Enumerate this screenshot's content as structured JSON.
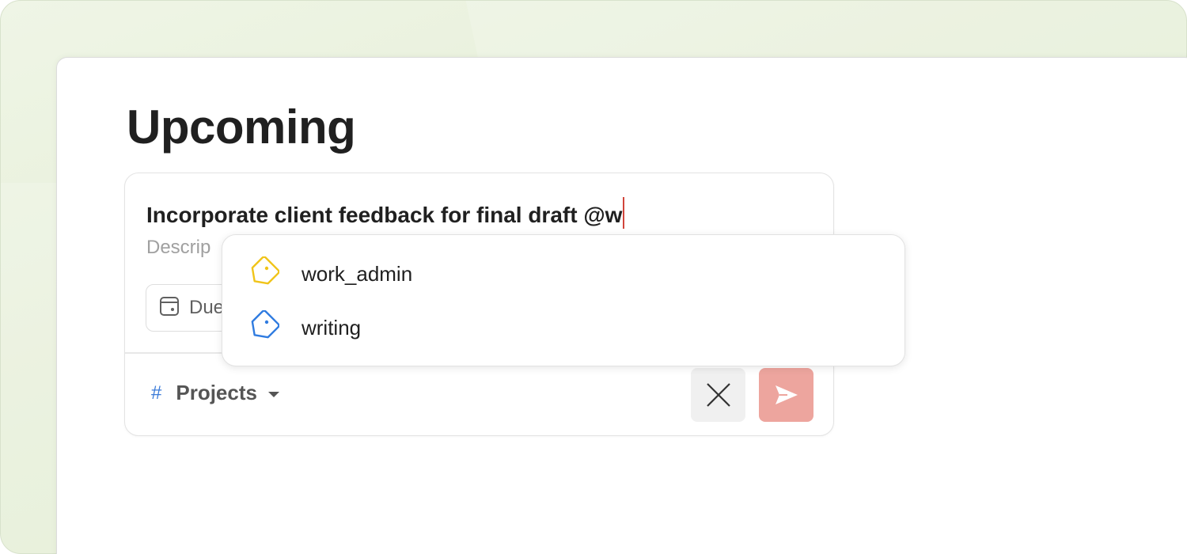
{
  "page": {
    "title": "Upcoming"
  },
  "task_editor": {
    "task_name": "Incorporate client feedback for final draft @w",
    "description_visible": "Descrip",
    "due_visible": "Due",
    "project_label": "Projects",
    "project_hash": "#",
    "accent_color": "#d1453b",
    "submit_color": "#eda59e"
  },
  "label_suggestions": [
    {
      "name": "work_admin",
      "icon": "tag-icon",
      "color": "#f0c419"
    },
    {
      "name": "writing",
      "icon": "tag-icon",
      "color": "#2f7be0"
    }
  ],
  "background": {
    "tint": "#e6efd8"
  }
}
